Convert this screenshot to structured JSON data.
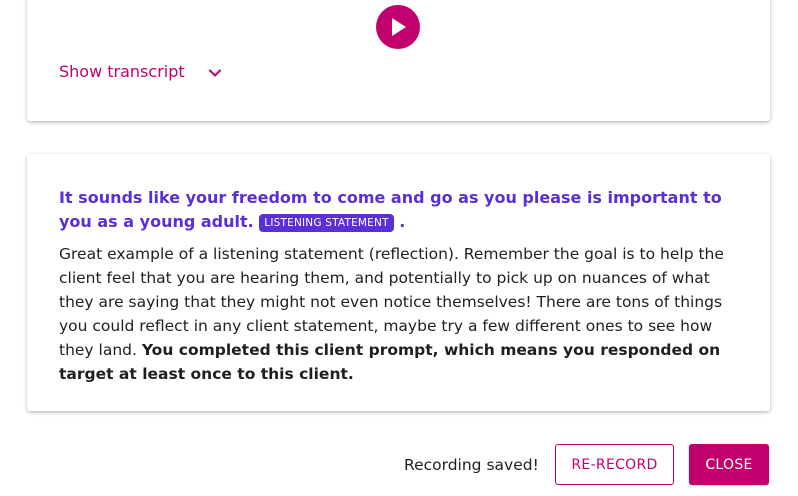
{
  "colors": {
    "accent": "#c2006d",
    "highlight": "#5b2fd6",
    "text": "#1f1f1f"
  },
  "audio": {
    "play_icon": "play-icon",
    "show_transcript_label": "Show transcript",
    "chevron_icon": "chevron-down-icon"
  },
  "feedback": {
    "response_text": "It sounds like your freedom to come and go as you please is important to you as a young adult.",
    "badge_label": "LISTENING STATEMENT",
    "response_trailing": ".",
    "body_text": "Great example of a listening statement (reflection). Remember the goal is to help the client feel that you are hearing them, and potentially to pick up on nuances of what they are saying that they might not even notice themselves! There are tons of things you could reflect in any client statement, maybe try a few different ones to see how they land.",
    "body_bold": "You completed this client prompt, which means you responded on target at least once to this client."
  },
  "footer": {
    "status_text": "Recording saved!",
    "rerecord_label": "RE-RECORD",
    "close_label": "CLOSE"
  }
}
